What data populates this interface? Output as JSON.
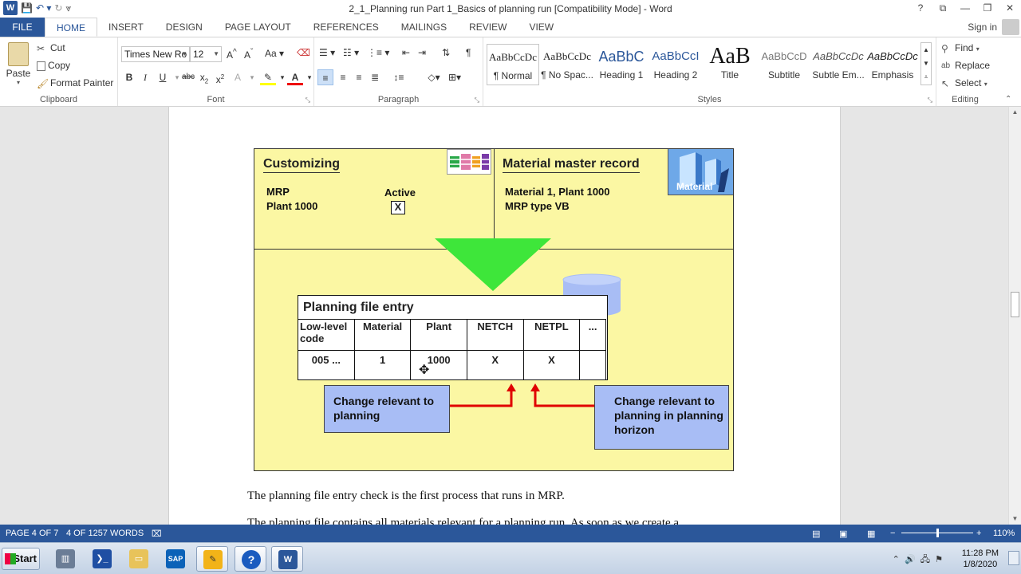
{
  "window": {
    "title": "2_1_Planning run Part 1_Basics of planning run [Compatibility Mode] - Word",
    "controls": [
      "?",
      "⧉",
      "—",
      "❐",
      "✕"
    ]
  },
  "ribbon_tabs": [
    "FILE",
    "HOME",
    "INSERT",
    "DESIGN",
    "PAGE LAYOUT",
    "REFERENCES",
    "MAILINGS",
    "REVIEW",
    "VIEW"
  ],
  "active_tab": "HOME",
  "signin_label": "Sign in",
  "clipboard": {
    "paste": "Paste",
    "cut": "Cut",
    "copy": "Copy",
    "format_painter": "Format Painter",
    "group_label": "Clipboard"
  },
  "font": {
    "family": "Times New Ro",
    "size": "12",
    "group_label": "Font"
  },
  "paragraph": {
    "group_label": "Paragraph"
  },
  "styles": {
    "group_label": "Styles",
    "items": [
      {
        "sample": "AaBbCcDc",
        "name": "¶ Normal"
      },
      {
        "sample": "AaBbCcDc",
        "name": "¶ No Spac..."
      },
      {
        "sample": "AaBbC",
        "name": "Heading 1"
      },
      {
        "sample": "AaBbCcI",
        "name": "Heading 2"
      },
      {
        "sample": "AaB",
        "name": "Title"
      },
      {
        "sample": "AaBbCcD",
        "name": "Subtitle"
      },
      {
        "sample": "AaBbCcDc",
        "name": "Subtle Em..."
      },
      {
        "sample": "AaBbCcDc",
        "name": "Emphasis"
      }
    ]
  },
  "editing": {
    "find": "Find",
    "replace": "Replace",
    "select": "Select",
    "group_label": "Editing"
  },
  "diagram": {
    "customizing_title": "Customizing",
    "mrp_label": "MRP",
    "plant_label": "Plant 1000",
    "active_label": "Active",
    "active_value": "X",
    "mmr_title": "Material master record",
    "material_line": "Material 1,   Plant 1000",
    "mrp_type_line": "MRP type   VB",
    "material_badge": "Material",
    "pfe_title": "Planning file entry",
    "pfe_headers": [
      "Low-level code",
      "Material",
      "Plant",
      "NETCH",
      "NETPL",
      "..."
    ],
    "pfe_row": [
      "005 ...",
      "1",
      "1000",
      "X",
      "X",
      ""
    ],
    "change_left": "Change relevant to planning",
    "change_right": "Change relevant to planning in planning horizon"
  },
  "body": {
    "line1": "The planning file entry check is the first process that runs in MRP.",
    "line2": "The planning file contains all materials relevant for a planning run. As soon as we create a"
  },
  "status": {
    "page": "PAGE 4 OF 7",
    "words": "4 OF 1257 WORDS",
    "zoom": "110%"
  },
  "taskbar": {
    "start": "Start",
    "time": "11:28 PM",
    "date": "1/8/2020"
  },
  "colors": {
    "word_blue": "#2b579a",
    "diagram_yellow": "#fbf7a3",
    "arrow_red": "#e00000",
    "triangle_green": "#3ee63a",
    "box_blue": "#a8bdf5"
  }
}
